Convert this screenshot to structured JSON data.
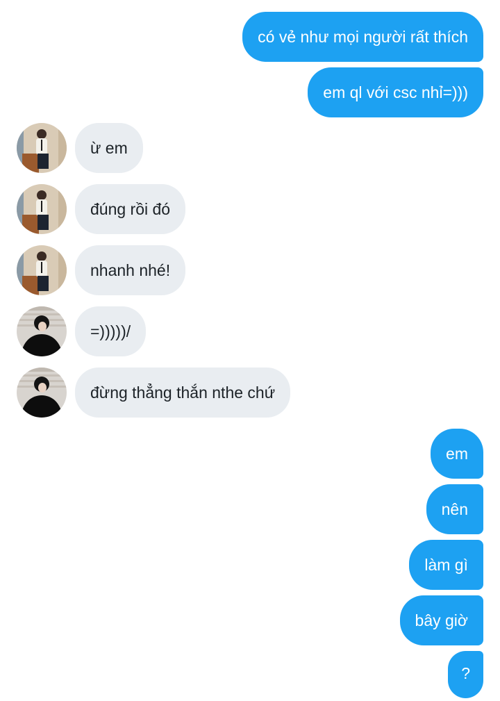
{
  "conversation": {
    "messages": [
      {
        "id": "m1",
        "direction": "outgoing",
        "text": "có vẻ như mọi người rất thích"
      },
      {
        "id": "m2",
        "direction": "outgoing",
        "text": "em ql với csc nhỉ=)))"
      },
      {
        "id": "m3",
        "direction": "incoming",
        "sender_avatar": "avatar-a",
        "text": "ừ em"
      },
      {
        "id": "m4",
        "direction": "incoming",
        "sender_avatar": "avatar-a",
        "text": "đúng rồi đó"
      },
      {
        "id": "m5",
        "direction": "incoming",
        "sender_avatar": "avatar-a",
        "text": "nhanh nhé!"
      },
      {
        "id": "m6",
        "direction": "incoming",
        "sender_avatar": "avatar-b",
        "text": "=)))))/"
      },
      {
        "id": "m7",
        "direction": "incoming",
        "sender_avatar": "avatar-b",
        "text": "đừng thẳng thắn nthe chứ"
      },
      {
        "id": "m8",
        "direction": "outgoing",
        "text": "em"
      },
      {
        "id": "m9",
        "direction": "outgoing",
        "text": "nên"
      },
      {
        "id": "m10",
        "direction": "outgoing",
        "text": "làm gì"
      },
      {
        "id": "m11",
        "direction": "outgoing",
        "text": "bây giờ"
      },
      {
        "id": "m12",
        "direction": "outgoing",
        "text": "?"
      }
    ]
  },
  "colors": {
    "outgoing_bubble": "#1da1f2",
    "incoming_bubble": "#e9edf1",
    "background": "#ffffff"
  }
}
